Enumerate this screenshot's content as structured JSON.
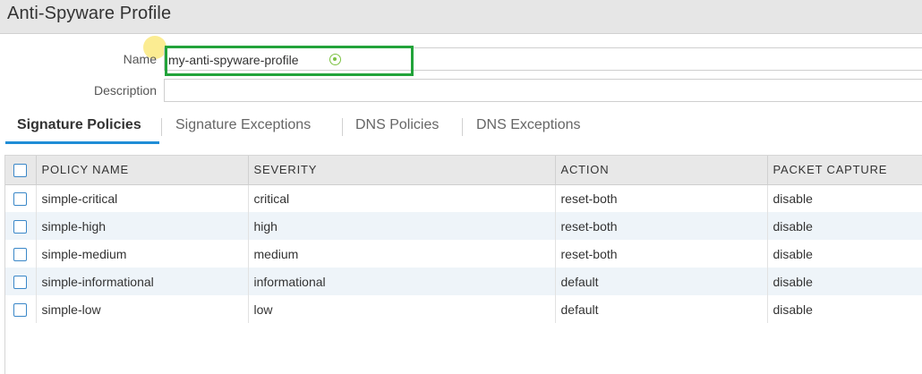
{
  "window": {
    "title": "Anti-Spyware Profile"
  },
  "form": {
    "name_label": "Name",
    "name_value": "my-anti-spyware-profile",
    "description_label": "Description",
    "description_value": ""
  },
  "tabs": [
    {
      "label": "Signature Policies",
      "active": true
    },
    {
      "label": "Signature Exceptions",
      "active": false
    },
    {
      "label": "DNS Policies",
      "active": false
    },
    {
      "label": "DNS Exceptions",
      "active": false
    }
  ],
  "table": {
    "columns": [
      "POLICY NAME",
      "SEVERITY",
      "ACTION",
      "PACKET CAPTURE"
    ],
    "rows": [
      [
        "simple-critical",
        "critical",
        "reset-both",
        "disable"
      ],
      [
        "simple-high",
        "high",
        "reset-both",
        "disable"
      ],
      [
        "simple-medium",
        "medium",
        "reset-both",
        "disable"
      ],
      [
        "simple-informational",
        "informational",
        "default",
        "disable"
      ],
      [
        "simple-low",
        "low",
        "default",
        "disable"
      ]
    ]
  },
  "colors": {
    "accent": "#1f8dd6",
    "highlight": "#22a33a",
    "status_ok": "#7cc242"
  },
  "icons": {
    "field_status": "check-circle-icon"
  }
}
